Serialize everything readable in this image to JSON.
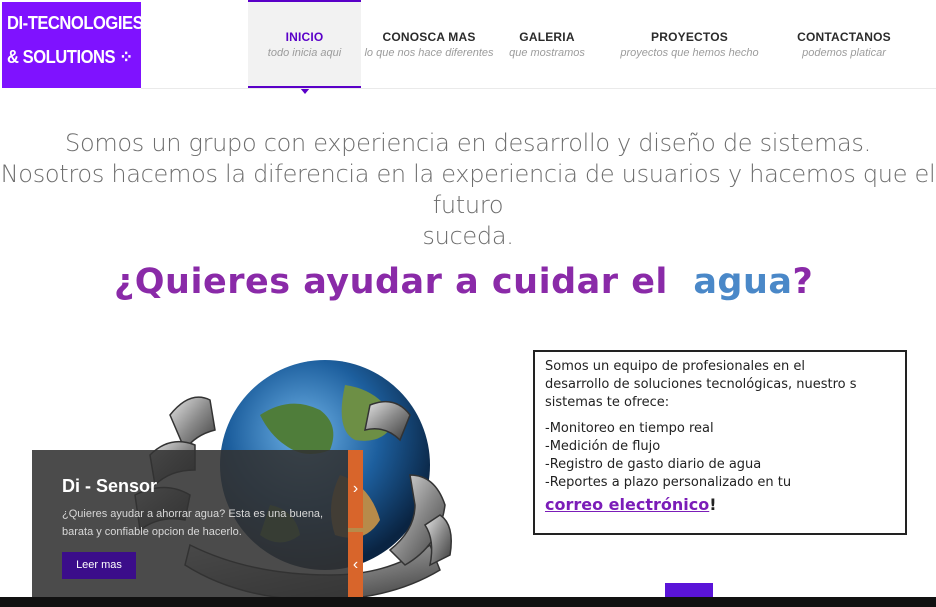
{
  "logo": {
    "line1": "DI-TECNOLOGIES",
    "line2": "& SOLUTIONS ⁘"
  },
  "nav": [
    {
      "title": "INICIO",
      "subtitle": "todo inicia aqui"
    },
    {
      "title": "CONOSCA MAS",
      "subtitle": "lo que nos hace diferentes"
    },
    {
      "title": "GALERIA",
      "subtitle": "que mostramos"
    },
    {
      "title": "PROYECTOS",
      "subtitle": "proyectos que hemos hecho"
    },
    {
      "title": "CONTACTANOS",
      "subtitle": "podemos platicar"
    }
  ],
  "intro": {
    "line1": "Somos un grupo con experiencia en desarrollo y diseño de sistemas.",
    "line2": "Nosotros hacemos la diferencia en la experiencia de usuarios y hacemos que el futuro",
    "line3": "suceda."
  },
  "banner": {
    "headline_part1": "¿Quieres ayudar a cuidar el",
    "headline_part2": "agua",
    "headline_part3": "?",
    "offer": {
      "line1": "Somos un equipo de profesionales en el",
      "line2": "desarrollo de soluciones tecnológicas, nuestro s",
      "line3": "sistemas te ofrece:",
      "items": [
        "-Monitoreo en tiempo real",
        "-Medición de flujo",
        "-Registro de gasto diario de agua",
        "-Reportes a plazo personalizado en  tu"
      ],
      "mail": "correo electrónico",
      "mail_suffix": "!"
    }
  },
  "slide": {
    "title": "Di - Sensor",
    "description": "¿Quieres ayudar a ahorrar agua? Esta es una buena, barata y confiable opcion de hacerlo.",
    "button": "Leer mas",
    "next_arrow": "›",
    "prev_arrow": "‹"
  },
  "colors": {
    "brand": "#7f12ff",
    "accent": "#5a00c8",
    "slider_arrow": "#d8652b"
  }
}
